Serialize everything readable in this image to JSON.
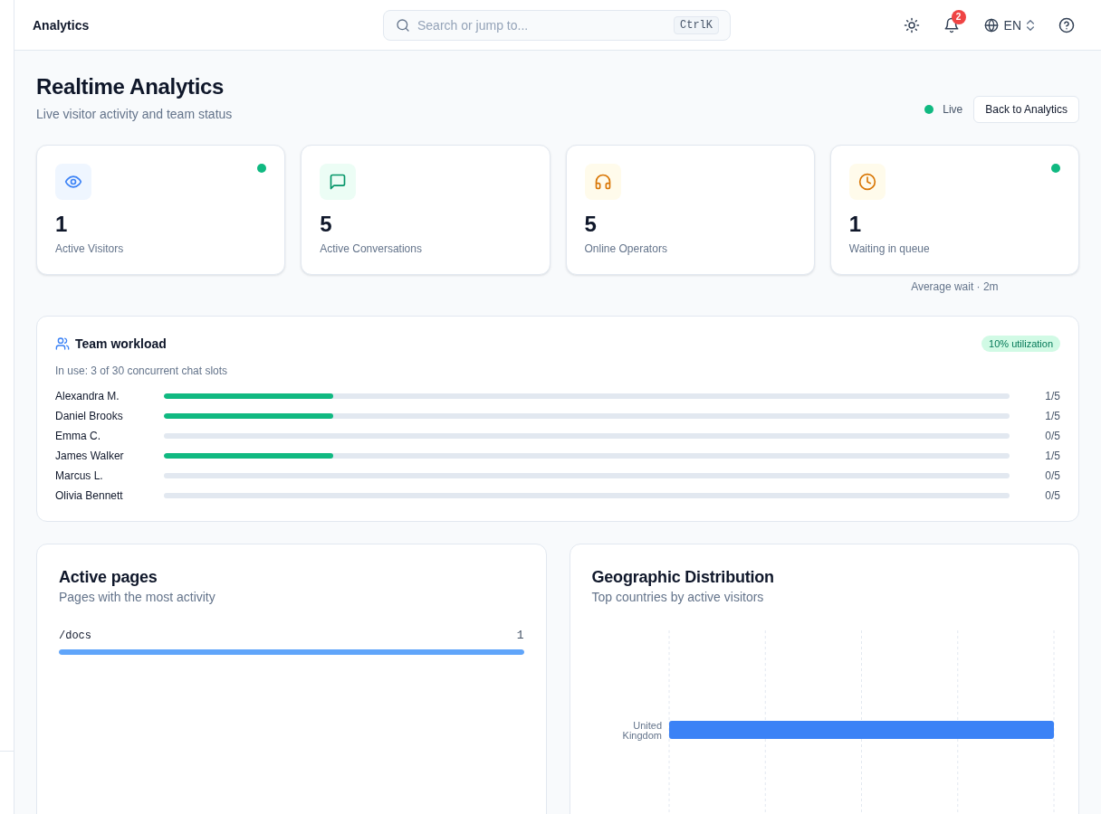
{
  "header": {
    "title": "Analytics",
    "search": {
      "placeholder": "Search or jump to...",
      "shortcut": "CtrlK"
    },
    "notifications": {
      "badge": "2"
    },
    "language": {
      "label": "EN"
    }
  },
  "page": {
    "title": "Realtime Analytics",
    "subtitle": "Live visitor activity and team status",
    "status": {
      "label": "Live",
      "live": true
    },
    "back_button": "Back to Analytics"
  },
  "stats": [
    {
      "kind": "visitors",
      "value": "1",
      "label": "Active Visitors",
      "live": true
    },
    {
      "kind": "conversations",
      "value": "5",
      "label": "Active Conversations",
      "live": false
    },
    {
      "kind": "operators",
      "value": "5",
      "label": "Online Operators",
      "live": false
    },
    {
      "kind": "queue",
      "value": "1",
      "label": "Waiting in queue",
      "live": true,
      "note": "Average wait · 2m"
    }
  ],
  "team_workload": {
    "title": "Team workload",
    "badge": "10% utilization",
    "summary": "In use: 3 of 30 concurrent chat slots",
    "members": [
      {
        "name": "Alexandra M.",
        "level": 0.2,
        "reading": "1/5"
      },
      {
        "name": "Daniel Brooks",
        "level": 0.2,
        "reading": "1/5"
      },
      {
        "name": "Emma C.",
        "reading": "0/5"
      },
      {
        "name": "James Walker",
        "level": 0.2,
        "reading": "1/5"
      },
      {
        "name": "Marcus L.",
        "reading": "0/5"
      },
      {
        "name": "Olivia Bennett",
        "reading": "0/5"
      }
    ]
  },
  "active_pages": {
    "title": "Active pages",
    "subtitle": "Pages with the most activity",
    "pages": [
      {
        "path": "/docs",
        "count": "1",
        "level": 1
      }
    ]
  },
  "geographic_distribution": {
    "title": "Geographic Distribution",
    "subtitle": "Top countries by active visitors",
    "countries": [
      "United Kingdom"
    ]
  }
}
